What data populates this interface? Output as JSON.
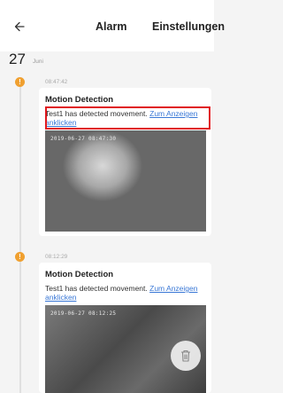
{
  "header": {
    "title": "Alarm",
    "settings_label": "Einstellungen",
    "back_icon": "arrow-left-icon"
  },
  "date": {
    "day": "27",
    "month": "Juni"
  },
  "events": [
    {
      "time": "08:47:42",
      "title": "Motion Detection",
      "message": "Test1 has detected movement.",
      "link_label": "Zum Anzeigen anklicken",
      "snapshot_timestamp": "2019-06-27 08:47:30",
      "status_icon": "alert-icon",
      "status_color": "#f0a030"
    },
    {
      "time": "08:12:29",
      "title": "Motion Detection",
      "message": "Test1 has detected movement.",
      "link_label": "Zum Anzeigen anklicken",
      "snapshot_timestamp": "2019-06-27 08:12:25",
      "status_icon": "alert-icon",
      "status_color": "#f0a030"
    }
  ],
  "delete_icon": "trash-icon",
  "highlight_color": "#e0181e",
  "accent_color": "#3a78d6"
}
